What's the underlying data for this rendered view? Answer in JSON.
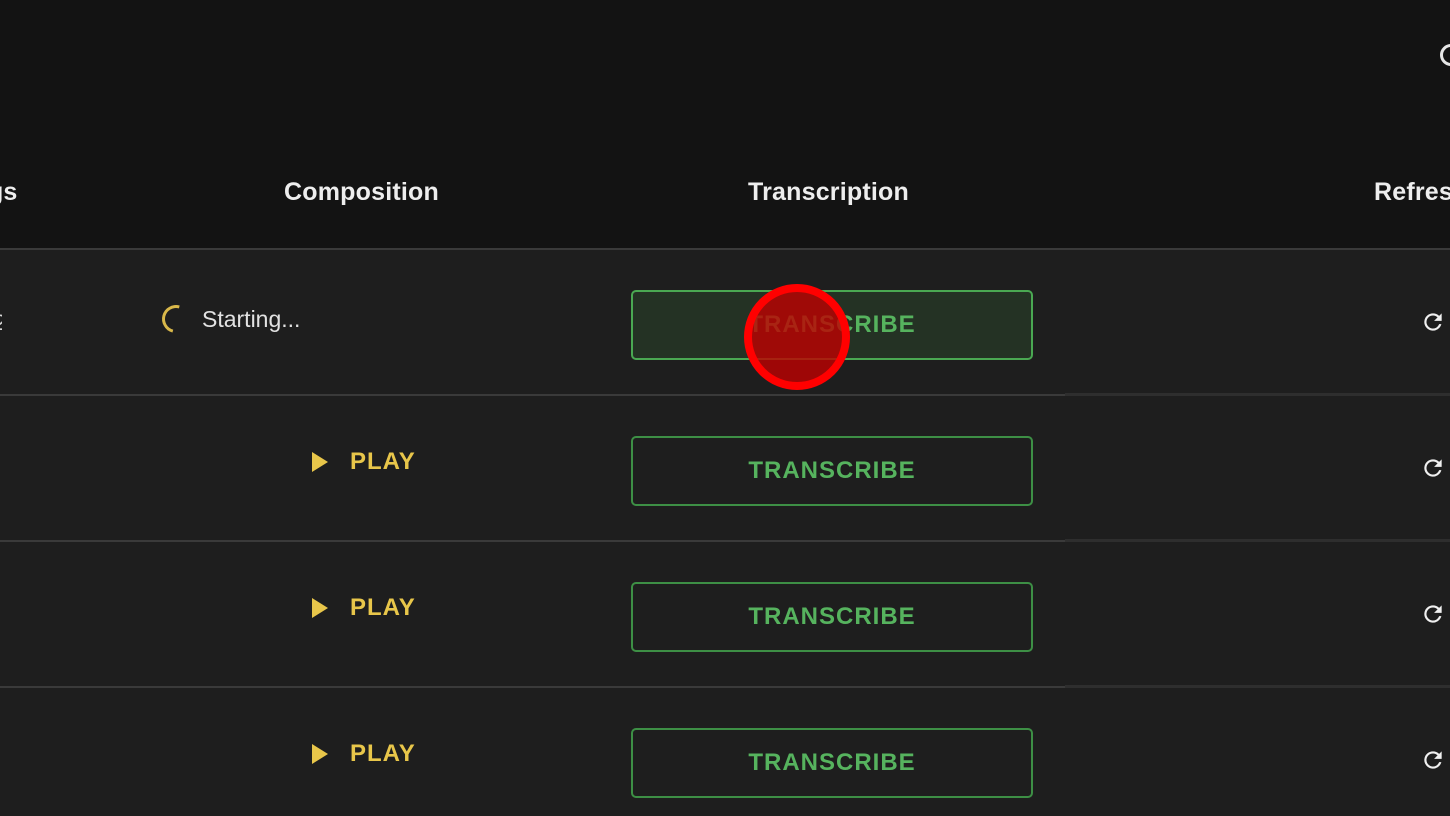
{
  "table": {
    "headers": {
      "recordings": "Recordings",
      "composition": "Composition",
      "transcription": "Transcription",
      "refresh": "Refresh"
    },
    "rows": [
      {
        "composition_status": "Starting...",
        "transcribe_label": "TRANSCRIBE",
        "state": "starting"
      },
      {
        "play_label": "PLAY",
        "transcribe_label": "TRANSCRIBE",
        "state": "ready"
      },
      {
        "play_label": "PLAY",
        "transcribe_label": "TRANSCRIBE",
        "state": "ready"
      },
      {
        "play_label": "PLAY",
        "transcribe_label": "TRANSCRIBE",
        "state": "ready"
      }
    ]
  },
  "colors": {
    "background": "#131313",
    "row_background": "#1e1e1e",
    "accent_yellow": "#e8c64a",
    "accent_green": "#56b35e",
    "click_marker": "#ff0000"
  },
  "icons": {
    "play": "play-icon",
    "refresh": "refresh-icon",
    "spinner": "spinner-icon"
  }
}
